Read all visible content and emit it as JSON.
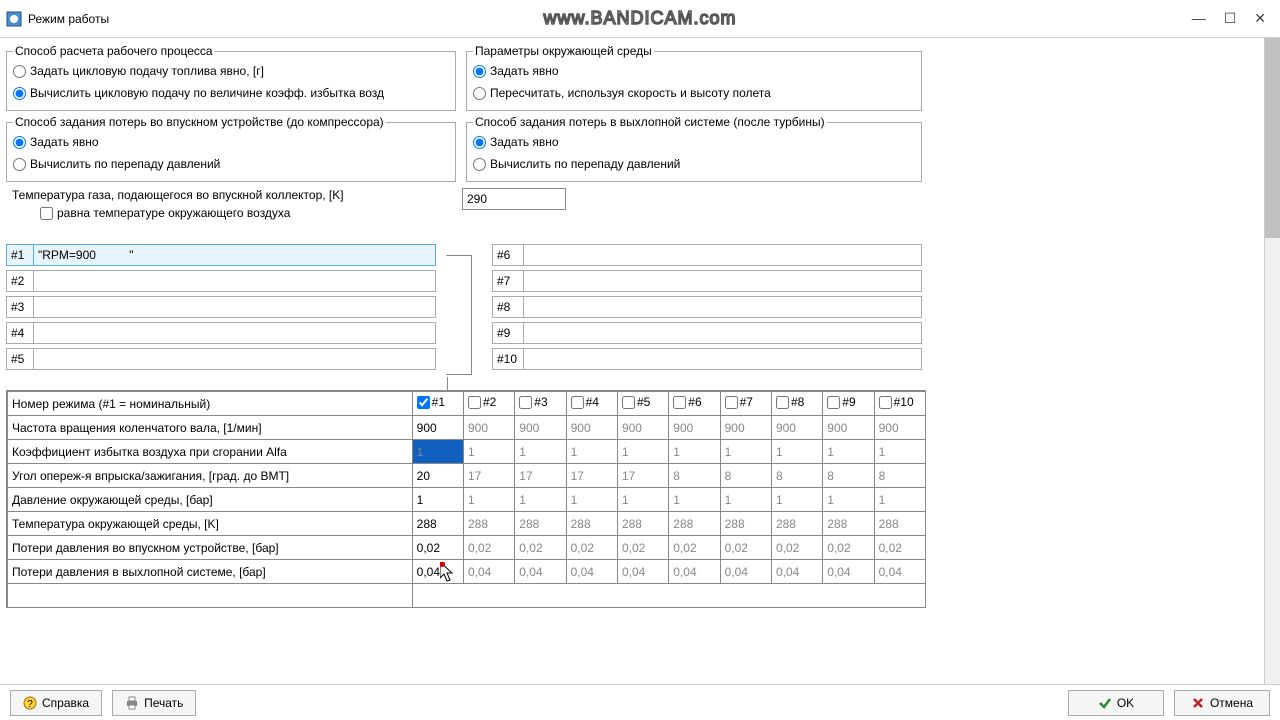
{
  "window": {
    "title": "Режим работы",
    "watermark": "www.BANDICAM.com"
  },
  "fs1": {
    "legend": "Способ расчета рабочего процесса",
    "opt1": "Задать цикловую подачу топлива явно, [г]",
    "opt2": "Вычислить цикловую подачу по величине коэфф. избытка возд"
  },
  "fs2": {
    "legend": "Параметры окружающей среды",
    "opt1": "Задать явно",
    "opt2": "Пересчитать, используя скорость и высоту полета"
  },
  "fs3": {
    "legend": "Способ задания потерь во впускном устройстве (до компрессора)",
    "opt1": "Задать явно",
    "opt2": "Вычислить по перепаду давлений"
  },
  "fs4": {
    "legend": "Способ задания потерь в выхлопной системе (после турбины)",
    "opt1": "Задать явно",
    "opt2": "Вычислить по перепаду давлений"
  },
  "temp": {
    "label": "Температура газа, подающегося во впускной коллектор, [K]",
    "checkbox": "равна температуре окружающего воздуха",
    "value": "290"
  },
  "modes": {
    "n1": "#1",
    "v1": "\"RPM=900          \"",
    "n2": "#2",
    "v2": "",
    "n3": "#3",
    "v3": "",
    "n4": "#4",
    "v4": "",
    "n5": "#5",
    "v5": "",
    "n6": "#6",
    "v6": "",
    "n7": "#7",
    "v7": "",
    "n8": "#8",
    "v8": "",
    "n9": "#9",
    "v9": "",
    "n10": "#10",
    "v10": ""
  },
  "table": {
    "header_row": "Номер режима (#1 = номинальный)",
    "cols": {
      "c1": "#1",
      "c2": "#2",
      "c3": "#3",
      "c4": "#4",
      "c5": "#5",
      "c6": "#6",
      "c7": "#7",
      "c8": "#8",
      "c9": "#9",
      "c10": "#10"
    },
    "rows": {
      "r1": {
        "label": "Частота вращения коленчатого вала, [1/мин]",
        "v": [
          "900",
          "900",
          "900",
          "900",
          "900",
          "900",
          "900",
          "900",
          "900",
          "900"
        ]
      },
      "r2": {
        "label": "Коэффициент избытка воздуха при сгорании Alfa",
        "v": [
          "1",
          "1",
          "1",
          "1",
          "1",
          "1",
          "1",
          "1",
          "1",
          "1"
        ]
      },
      "r3": {
        "label": "Угол опереж-я впрыска/зажигания, [град. до ВМТ]",
        "v": [
          "20",
          "17",
          "17",
          "17",
          "17",
          "8",
          "8",
          "8",
          "8",
          "8"
        ]
      },
      "r4": {
        "label": "Давление окружающей среды, [бар]",
        "v": [
          "1",
          "1",
          "1",
          "1",
          "1",
          "1",
          "1",
          "1",
          "1",
          "1"
        ]
      },
      "r5": {
        "label": "Температура окружающей среды, [K]",
        "v": [
          "288",
          "288",
          "288",
          "288",
          "288",
          "288",
          "288",
          "288",
          "288",
          "288"
        ]
      },
      "r6": {
        "label": "Потери давления во впускном устройстве, [бар]",
        "v": [
          "0,02",
          "0,02",
          "0,02",
          "0,02",
          "0,02",
          "0,02",
          "0,02",
          "0,02",
          "0,02",
          "0,02"
        ]
      },
      "r7": {
        "label": "Потери давления в выхлопной системе, [бар]",
        "v": [
          "0,04",
          "0,04",
          "0,04",
          "0,04",
          "0,04",
          "0,04",
          "0,04",
          "0,04",
          "0,04",
          "0,04"
        ]
      }
    }
  },
  "footer": {
    "help": "Справка",
    "print": "Печать",
    "ok": "OK",
    "cancel": "Отмена"
  }
}
